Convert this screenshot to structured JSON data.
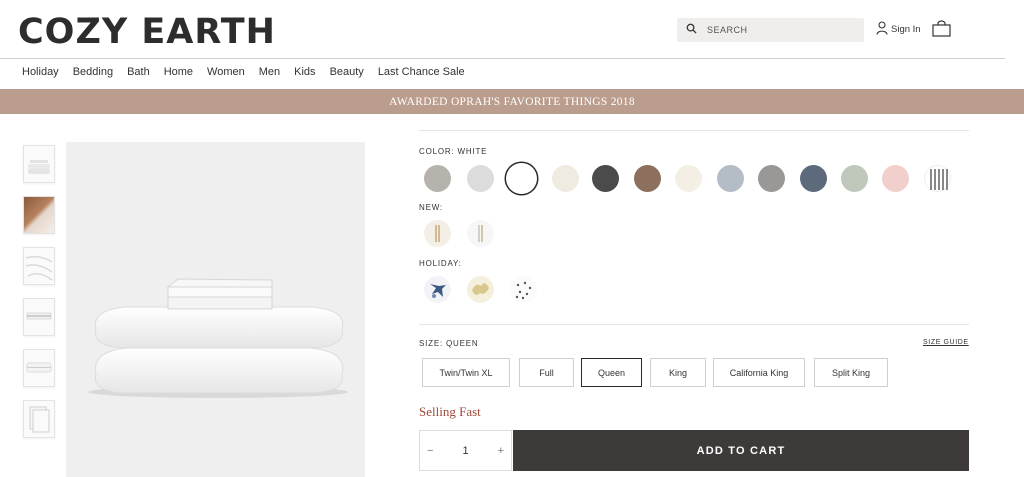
{
  "brand": {
    "logo_text": "COZY EARTH"
  },
  "header": {
    "search_placeholder": "SEARCH",
    "sign_in_label": "Sign In"
  },
  "nav": {
    "items": [
      "Holiday",
      "Bedding",
      "Bath",
      "Home",
      "Women",
      "Men",
      "Kids",
      "Beauty",
      "Last Chance Sale"
    ]
  },
  "banner": {
    "text": "AWARDED OPRAH'S FAVORITE THINGS 2018"
  },
  "product": {
    "color_label": "COLOR: WHITE",
    "colors": [
      {
        "name": "stone",
        "hex": "#b6b2ac"
      },
      {
        "name": "light-grey",
        "hex": "#dcdcdc"
      },
      {
        "name": "white",
        "hex": "#ffffff",
        "selected": true
      },
      {
        "name": "cream",
        "hex": "#f0ebe1"
      },
      {
        "name": "charcoal",
        "hex": "#4b4b4b"
      },
      {
        "name": "driftwood",
        "hex": "#8d6f5d"
      },
      {
        "name": "ivory",
        "hex": "#f3efe4"
      },
      {
        "name": "fog-blue",
        "hex": "#b4bdc6"
      },
      {
        "name": "pewter",
        "hex": "#999896"
      },
      {
        "name": "slate-blue",
        "hex": "#5c6a7b"
      },
      {
        "name": "sage",
        "hex": "#bfc8bb"
      },
      {
        "name": "blush",
        "hex": "#f1cfcc"
      },
      {
        "name": "pinstripe",
        "hex": "#ffffff"
      }
    ],
    "new_label": "NEW:",
    "holiday_label": "HOLIDAY:",
    "size_label": "SIZE: QUEEN",
    "size_guide_label": "SIZE GUIDE",
    "sizes": [
      "Twin/Twin XL",
      "Full",
      "Queen",
      "King",
      "California King",
      "Split King"
    ],
    "selected_size": "Queen",
    "status_text": "Selling Fast",
    "quantity": "1",
    "qty_minus": "−",
    "qty_plus": "+",
    "add_to_cart_label": "ADD TO CART"
  }
}
